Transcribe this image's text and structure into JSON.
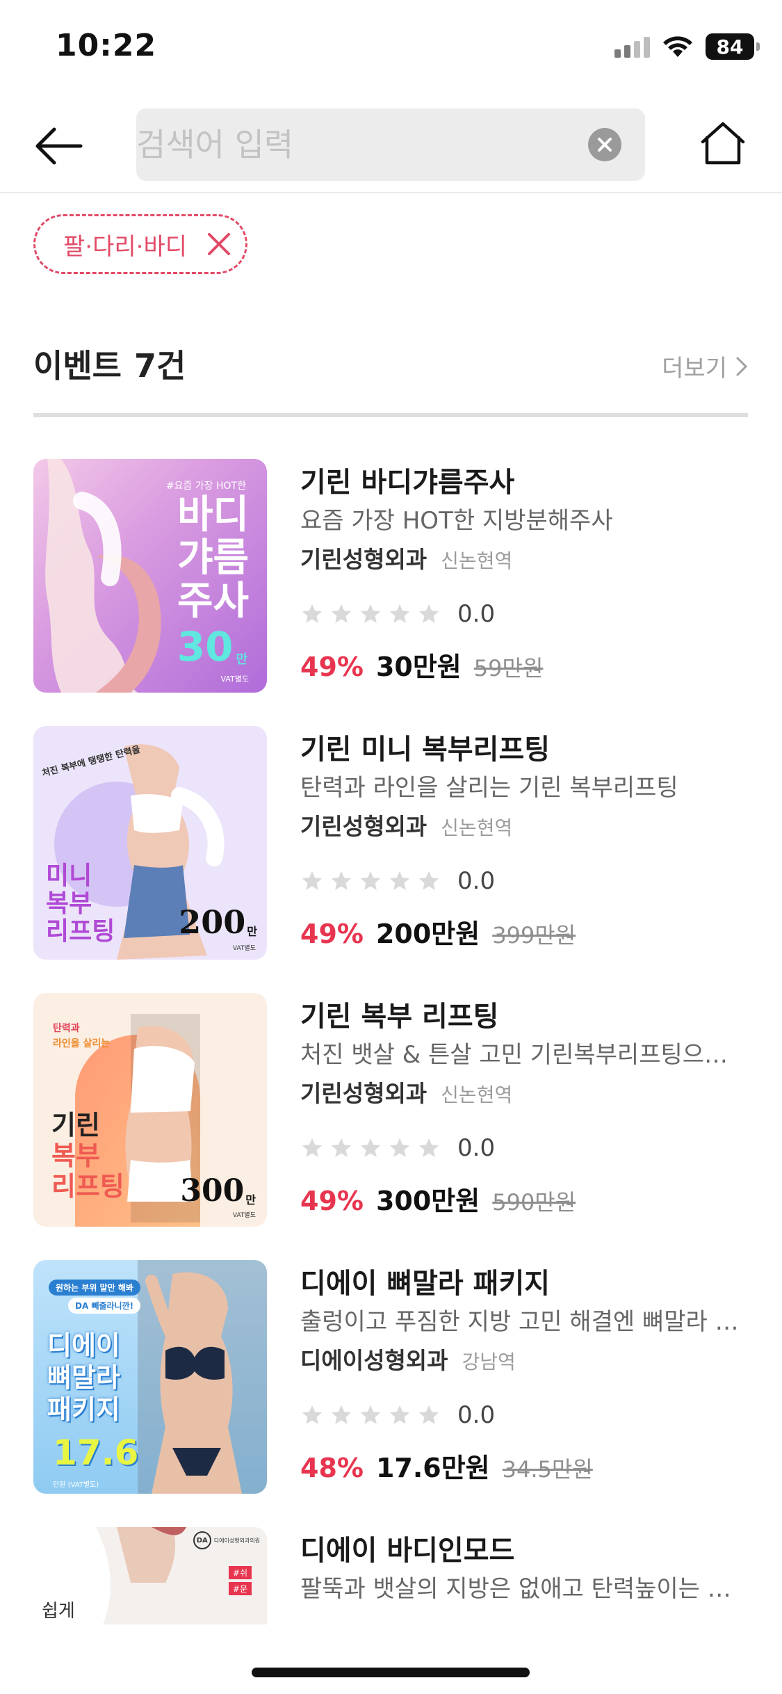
{
  "status_bar": {
    "time": "10:22",
    "battery": "84"
  },
  "search": {
    "placeholder": "검색어 입력",
    "value": ""
  },
  "filter": {
    "chip_label": "팔·다리·바디"
  },
  "section": {
    "title": "이벤트",
    "count": "7건",
    "more": "더보기"
  },
  "colors": {
    "accent": "#e8354f",
    "chip": "#e24a67",
    "star": "#d9d9d9"
  },
  "events": [
    {
      "title": "기린 바디갸름주사",
      "desc": "요즘 가장 HOT한 지방분해주사",
      "clinic": "기린성형외과",
      "station": "신논현역",
      "rating": "0.0",
      "discount": "49%",
      "price": "30만원",
      "original": "59만원",
      "thumb": {
        "tag": "#요즘 가장 HOT한",
        "lines": [
          "바디",
          "갸름",
          "주사"
        ],
        "price": "30",
        "unit": "만",
        "note": "VAT별도"
      }
    },
    {
      "title": "기린 미니 복부리프팅",
      "desc": "탄력과 라인을 살리는 기린 복부리프팅",
      "clinic": "기린성형외과",
      "station": "신논현역",
      "rating": "0.0",
      "discount": "49%",
      "price": "200만원",
      "original": "399만원",
      "thumb": {
        "tag": "처진 복부에 탱탱한 탄력을",
        "lines": [
          "미니",
          "복부",
          "리프팅"
        ],
        "price": "200",
        "unit": "만",
        "note": "VAT별도"
      }
    },
    {
      "title": "기린 복부 리프팅",
      "desc": "처진 뱃살 & 튼살 고민 기린복부리프팅으로 ...",
      "clinic": "기린성형외과",
      "station": "신논현역",
      "rating": "0.0",
      "discount": "49%",
      "price": "300만원",
      "original": "590만원",
      "thumb": {
        "tag1": "탄력과",
        "tag2": "라인을 살리는",
        "lines": [
          "기린",
          "복부",
          "리프팅"
        ],
        "price": "300",
        "unit": "만",
        "note": "VAT별도"
      }
    },
    {
      "title": "디에이 뼈말라 패키지",
      "desc": "출렁이고 푸짐한 지방 고민 해결엔 뼈말라 패...",
      "clinic": "디에이성형외과",
      "station": "강남역",
      "rating": "0.0",
      "discount": "48%",
      "price": "17.6만원",
      "original": "34.5만원",
      "thumb": {
        "tag1": "원하는 부위 말만 해봐",
        "tag2": "DA 빼줄라니깐!",
        "lines": [
          "디에이",
          "뼈말라",
          "패키지"
        ],
        "price": "17.6",
        "note": "만원 (VAT별도)"
      }
    },
    {
      "title": "디에이 바디인모드",
      "desc": "팔뚝과 뱃살의 지방은 없애고 탄력높이는 디...",
      "thumb": {
        "logo": "DA",
        "logo_text": "디에이성형외과의원",
        "caption": "쉽게",
        "tags": [
          "#쉬",
          "#운"
        ]
      }
    }
  ]
}
